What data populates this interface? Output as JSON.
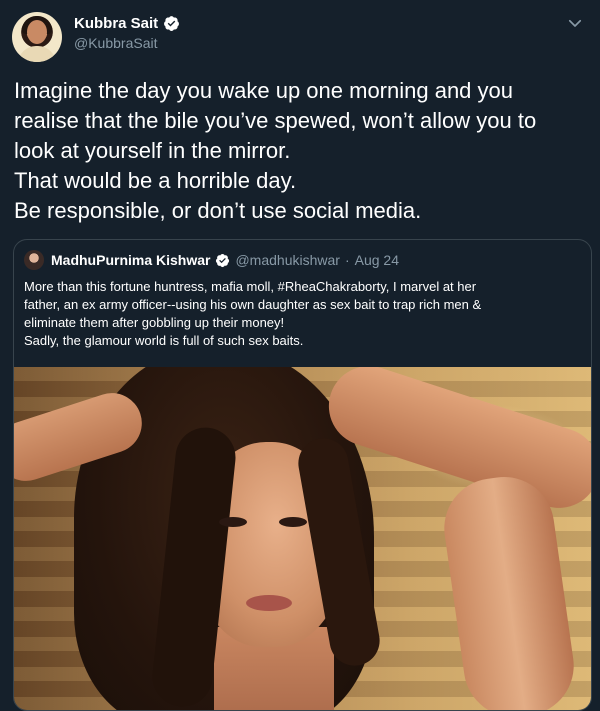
{
  "tweet": {
    "author": {
      "display_name": "Kubbra Sait",
      "handle": "@KubbraSait",
      "verified": true
    },
    "text_lines": [
      "Imagine the day you wake up one morning and you",
      "realise that the bile you’ve spewed, won’t allow you to",
      "look at yourself in the mirror.",
      "That would be a horrible day.",
      "Be responsible, or don’t use social media."
    ],
    "menu_icon": "chevron-down-icon"
  },
  "quoted_tweet": {
    "author": {
      "display_name": "MadhuPurnima Kishwar",
      "handle": "@madhukishwar",
      "verified": true
    },
    "separator": "·",
    "date": "Aug 24",
    "text_lines": [
      "More than this fortune huntress, mafia moll, #RheaChakraborty, I marvel at her",
      "father, an ex army officer--using his own daughter as sex bait to trap rich men &",
      "eliminate them after gobbling up their money!",
      "Sadly, the glamour world is full of such sex baits."
    ]
  },
  "colors": {
    "background": "#15202b",
    "secondary_text": "#8899a6",
    "verified_badge": "#ffffff",
    "border": "#38444d"
  }
}
